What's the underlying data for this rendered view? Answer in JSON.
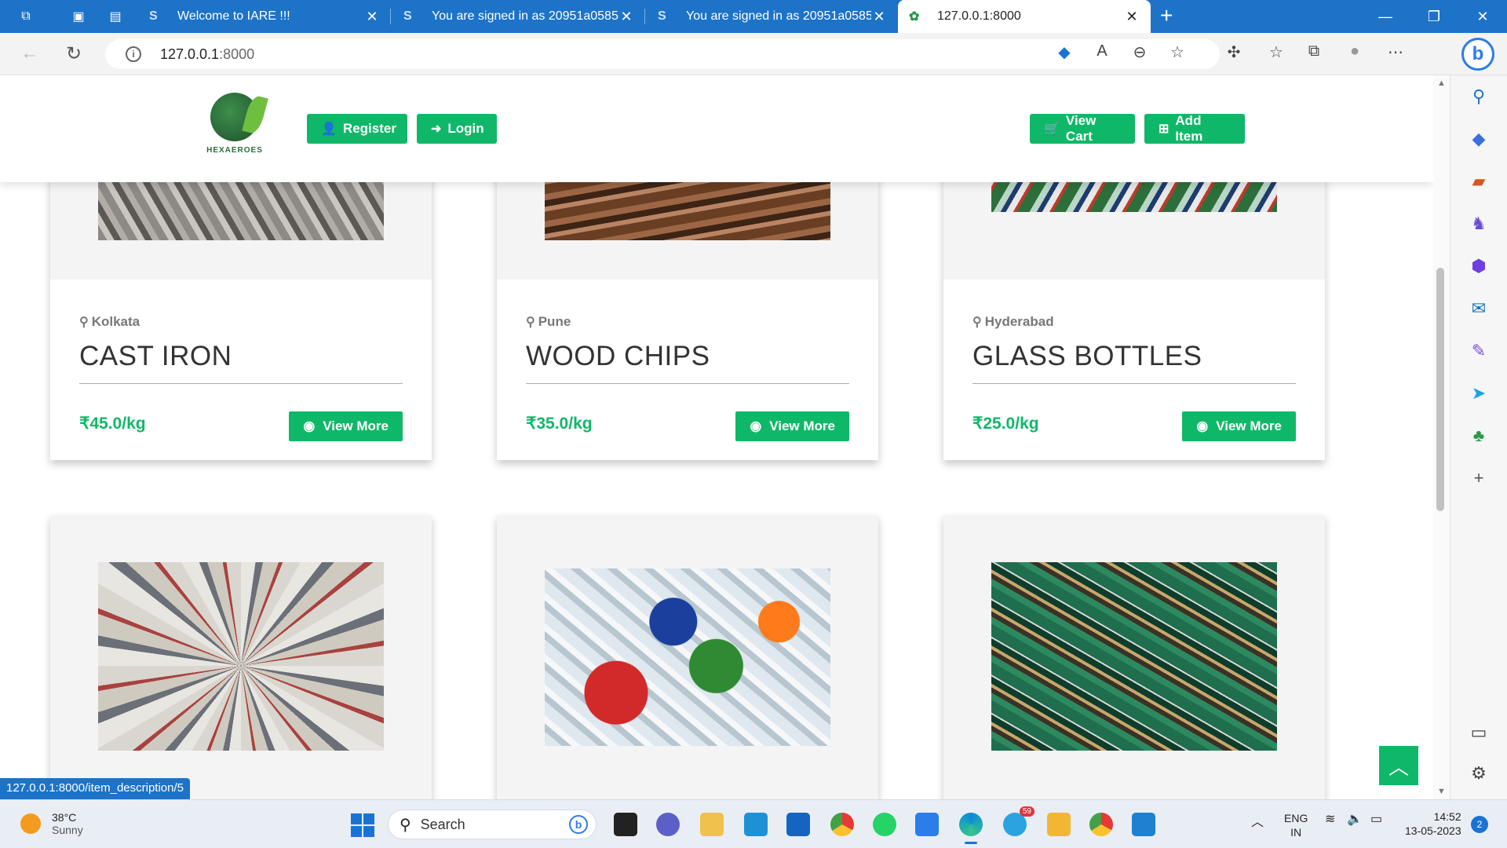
{
  "browser": {
    "tabs": [
      {
        "icon": "tab-actions-icon",
        "title": "Welcome to IARE !!!",
        "favicon": "S"
      },
      {
        "title": "You are signed in as 20951a0585",
        "favicon": "S"
      },
      {
        "title": "You are signed in as 20951a0585",
        "favicon": "S"
      },
      {
        "title": "127.0.0.1:8000",
        "favicon": "hexaeroes-favicon"
      }
    ],
    "url_host": "127.0.0.1",
    "url_port": ":8000",
    "status_url": "127.0.0.1:8000/item_description/5"
  },
  "site": {
    "logo_text": "HEXAEROES",
    "nav": {
      "register": "Register",
      "login": "Login",
      "view_cart": "View Cart",
      "add_item": "Add Item"
    },
    "accent_color": "#0fb868"
  },
  "items": [
    {
      "location": "Kolkata",
      "name": "CAST IRON",
      "price": "₹45.0/kg",
      "button": "View More"
    },
    {
      "location": "Pune",
      "name": "WOOD CHIPS",
      "price": "₹35.0/kg",
      "button": "View More"
    },
    {
      "location": "Hyderabad",
      "name": "GLASS BOTTLES",
      "price": "₹25.0/kg",
      "button": "View More"
    },
    {
      "image": "paper-scrap"
    },
    {
      "image": "plastic-bottles"
    },
    {
      "image": "e-waste"
    }
  ],
  "taskbar": {
    "weather_temp": "38°C",
    "weather_desc": "Sunny",
    "search_label": "Search",
    "telegram_badge": "59",
    "lang_top": "ENG",
    "lang_bottom": "IN",
    "time": "14:52",
    "date": "13-05-2023",
    "notifications": "2"
  }
}
